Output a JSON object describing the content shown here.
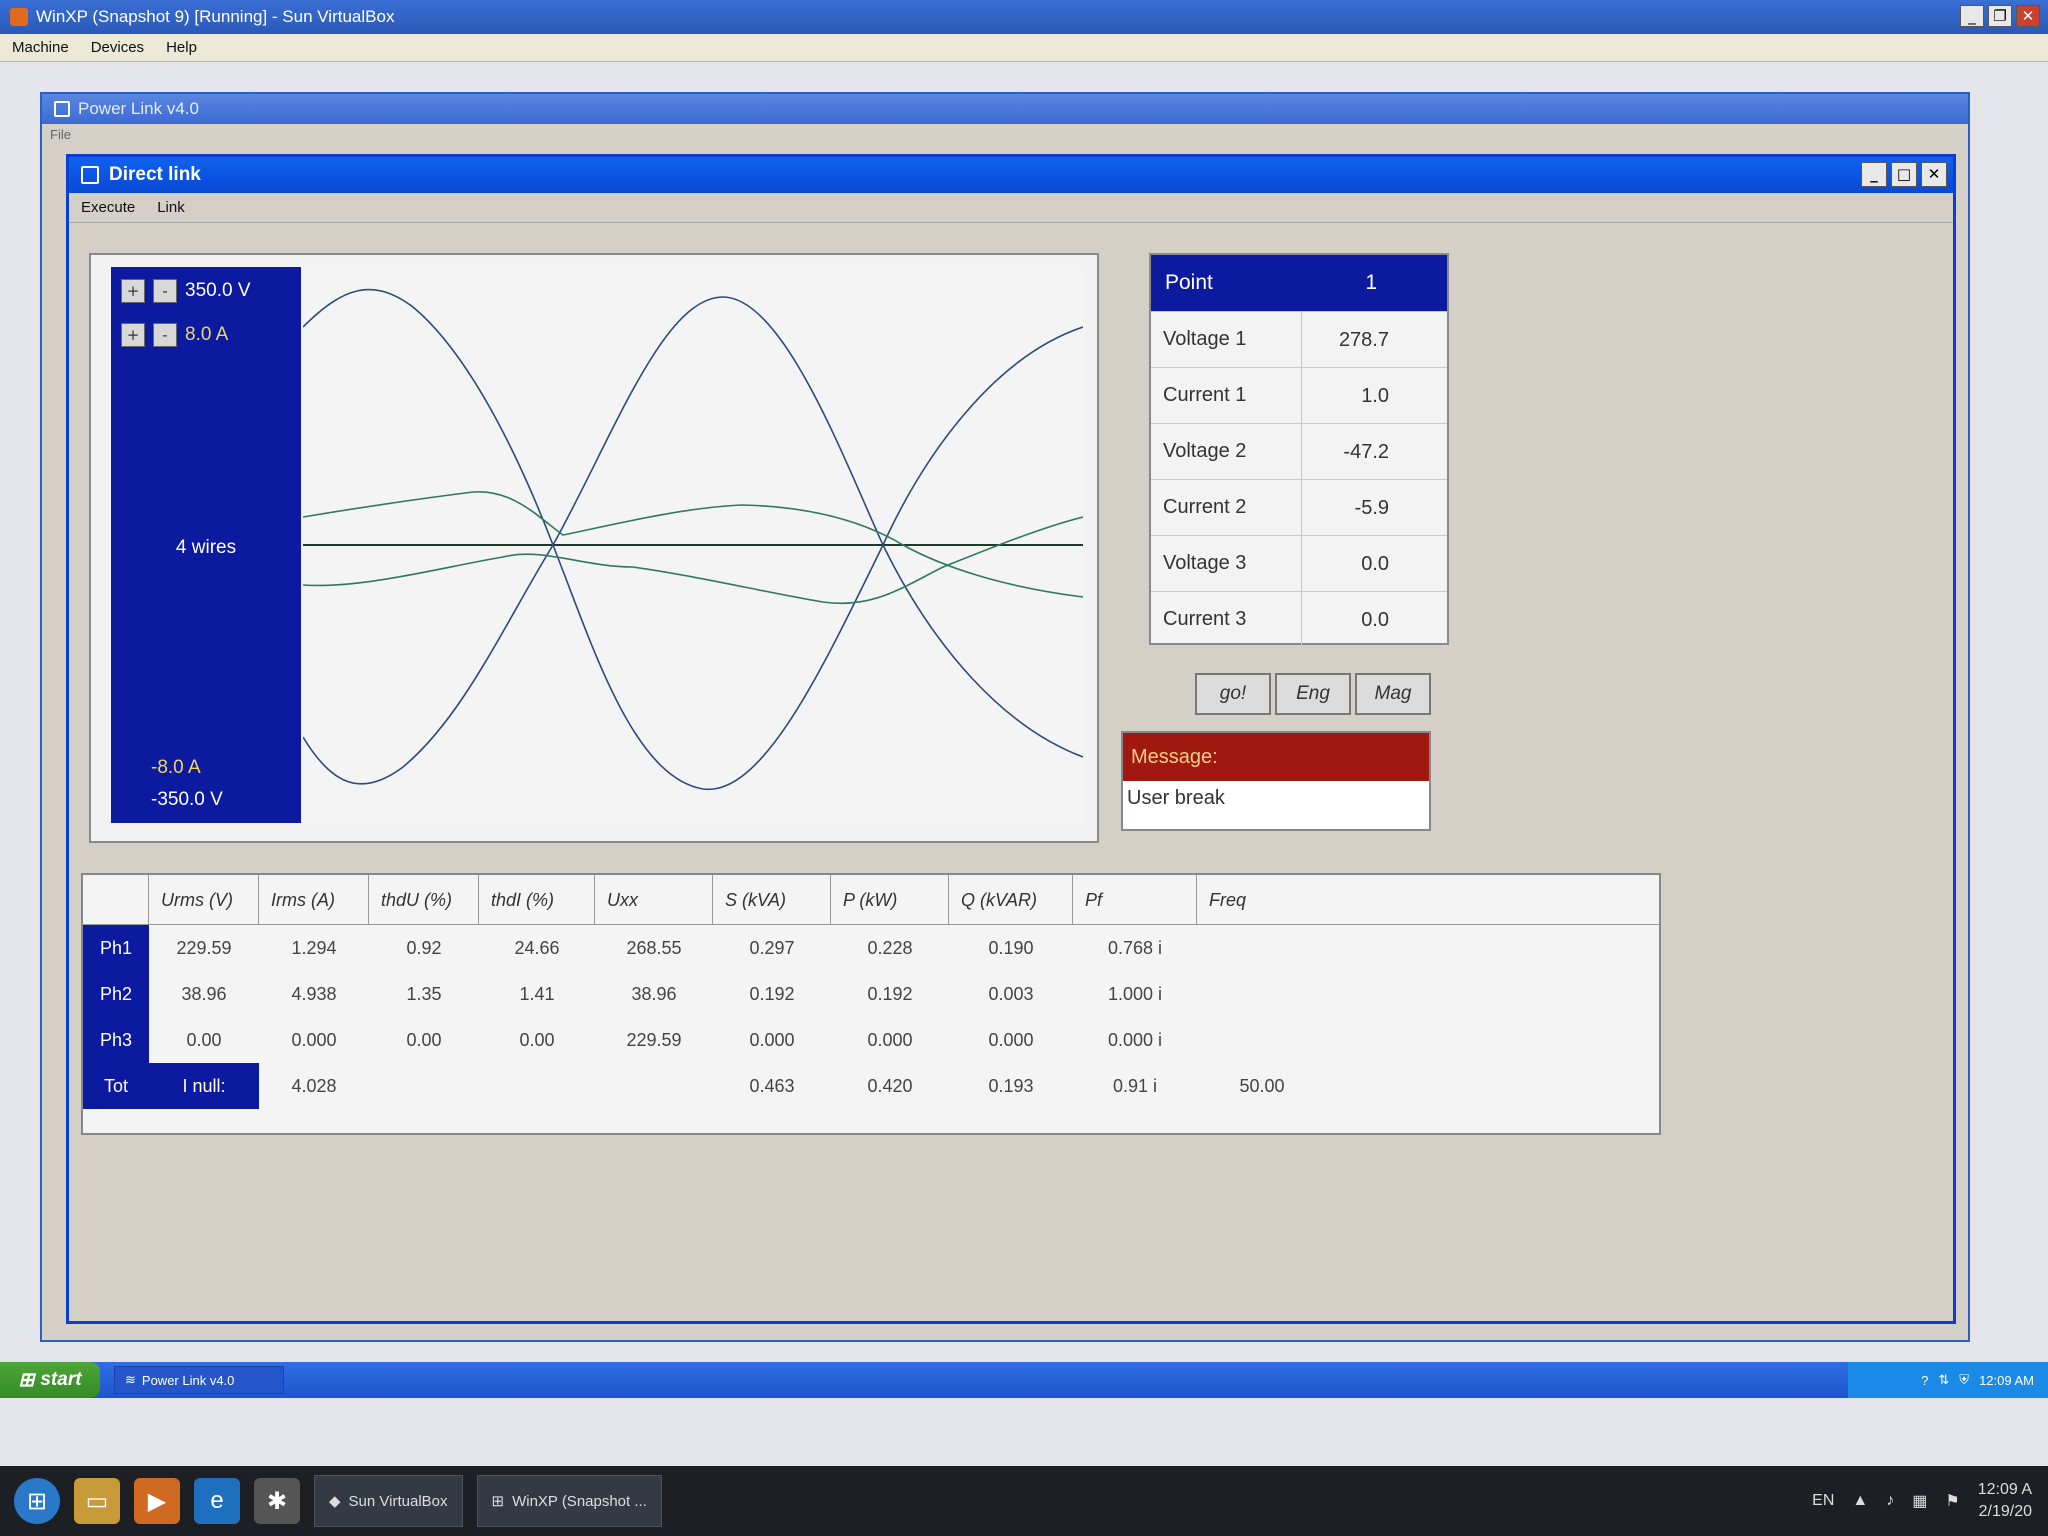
{
  "vbox": {
    "title": "WinXP (Snapshot 9) [Running] - Sun VirtualBox",
    "menu": [
      "Machine",
      "Devices",
      "Help"
    ]
  },
  "powerlink": {
    "title": "Power Link  v4.0",
    "menu_file": "File"
  },
  "directlink": {
    "title": "Direct link",
    "menu": [
      "Execute",
      "Link"
    ]
  },
  "scope": {
    "plus": "+",
    "minus": "-",
    "v_max": "350.0 V",
    "a_max": "8.0 A",
    "wires": "4 wires",
    "a_min": "-8.0 A",
    "v_min": "-350.0 V"
  },
  "point": {
    "label": "Point",
    "value": "1",
    "rows": [
      {
        "label": "Voltage 1",
        "value": "278.7"
      },
      {
        "label": "Current 1",
        "value": "1.0"
      },
      {
        "label": "Voltage 2",
        "value": "-47.2"
      },
      {
        "label": "Current 2",
        "value": "-5.9"
      },
      {
        "label": "Voltage 3",
        "value": "0.0"
      },
      {
        "label": "Current 3",
        "value": "0.0"
      }
    ]
  },
  "buttons": {
    "go": "go!",
    "eng": "Eng",
    "mag": "Mag"
  },
  "message": {
    "label": "Message:",
    "text": "User break"
  },
  "results": {
    "headers": [
      "",
      "Urms (V)",
      "Irms (A)",
      "thdU (%)",
      "thdI (%)",
      "Uxx",
      "S (kVA)",
      "P (kW)",
      "Q (kVAR)",
      "Pf",
      "Freq"
    ],
    "rows": [
      {
        "ph": "Ph1",
        "cells": [
          "229.59",
          "1.294",
          "0.92",
          "24.66",
          "268.55",
          "0.297",
          "0.228",
          "0.190",
          "0.768  i",
          ""
        ]
      },
      {
        "ph": "Ph2",
        "cells": [
          "38.96",
          "4.938",
          "1.35",
          "1.41",
          "38.96",
          "0.192",
          "0.192",
          "0.003",
          "1.000  i",
          ""
        ]
      },
      {
        "ph": "Ph3",
        "cells": [
          "0.00",
          "0.000",
          "0.00",
          "0.00",
          "229.59",
          "0.000",
          "0.000",
          "0.000",
          "0.000  i",
          ""
        ]
      }
    ],
    "tot_label": "Tot",
    "inull_label": "I null:",
    "inull_value": "4.028",
    "tot_cells": [
      "0.463",
      "0.420",
      "0.193",
      "0.91  i",
      "50.00"
    ]
  },
  "guest_taskbar": {
    "start": "start",
    "app": "Power Link  v4.0",
    "clock": "12:09 AM"
  },
  "host_taskbar": {
    "apps": [
      "Sun VirtualBox",
      "WinXP (Snapshot ..."
    ],
    "lang": "EN",
    "time": "12:09 A",
    "date": "2/19/20"
  }
}
